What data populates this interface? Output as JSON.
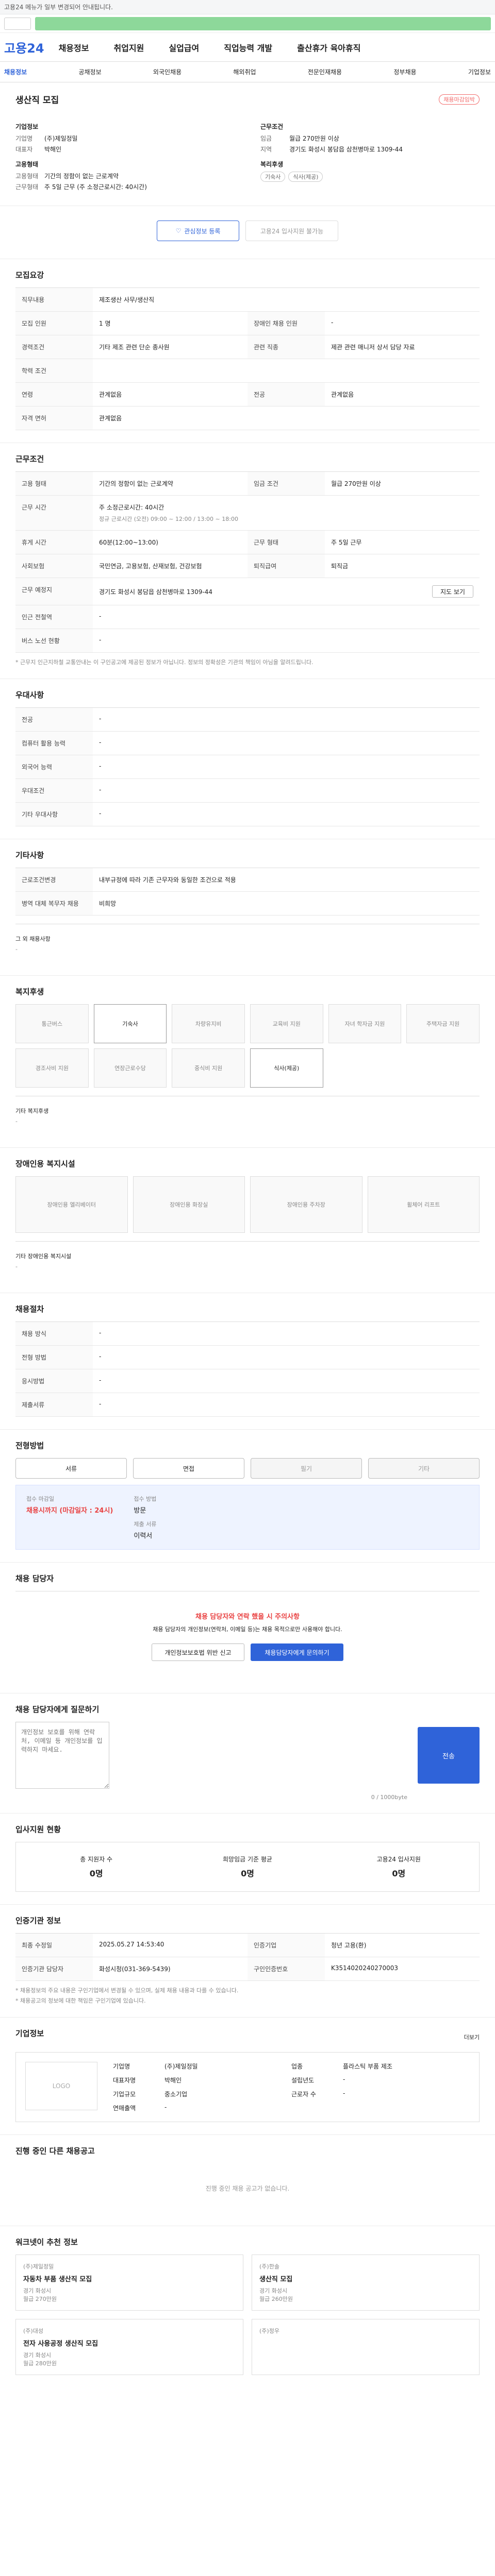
{
  "top_notice": "고용24 메뉴가 일부 변경되어 안내됩니다.",
  "ad_banner": "",
  "brand": {
    "name": "고용24"
  },
  "nav": [
    "채용정보",
    "취업지원",
    "실업급여",
    "직업능력 개발",
    "출산휴가 육아휴직"
  ],
  "subnav": [
    "채용정보",
    "공채정보",
    "외국인채용",
    "해외취업",
    "전문인재채용",
    "정부채용",
    "기업정보"
  ],
  "job": {
    "title": "생산직 모집",
    "badge": "채용마감임박",
    "company_label": "기업정보",
    "company_name": "(주)제일정밀",
    "representative": "박해인",
    "industry": "",
    "work_condition_label": "근무조건",
    "pay_label": "임금",
    "pay_value": "월급 270만원 이상",
    "location_label": "지역",
    "location_value": "경기도 화성시 봉담읍 삼천병마로 1309-44",
    "hire_type_label": "고용형태",
    "hire_type_value": "기간의 정함이 없는 근로계약",
    "working_form_label": "근무형태",
    "working_form_value": "주 5일 근무 (주 소정근로시간: 40시간)",
    "welfare_label": "복리후생",
    "welfare_items": [
      "기숙사",
      "식사(제공)"
    ]
  },
  "actions": {
    "interest_btn": "관심정보 등록",
    "apply_btn": "고용24 입사지원 불가능"
  },
  "recruit": {
    "title": "모집요강",
    "job_label": "직무내용",
    "job_value": "제조생산 사무/생산직",
    "rows": [
      {
        "k": "모집 인원",
        "v": "1 명",
        "k2": "장애인 채용 인원",
        "v2": "-"
      },
      {
        "k": "경력조건",
        "v": "기타 제조 관련 단순 종사원",
        "k2": "관련 직종",
        "v2": "제관 관련 매니저 상서 담당 자료"
      },
      {
        "k": "학력 조건",
        "v": "",
        "k2": "",
        "v2": ""
      },
      {
        "k": "연령",
        "v": "관계없음",
        "k2": "전공",
        "v2": "관계없음"
      },
      {
        "k": "자격 면허",
        "v": "관계없음",
        "k2": "",
        "v2": ""
      }
    ]
  },
  "conditions": {
    "title": "근무조건",
    "rows": [
      {
        "k": "고용 형태",
        "v": "기간의 정함이 없는 근로계약",
        "k2": "임금 조건",
        "v2": "월급 270만원 이상"
      },
      {
        "k": "근무 시간",
        "v": "주 소정근로시간: 40시간",
        "k2": "",
        "v2": ""
      },
      {
        "k": "",
        "v": "정규 근로시간 (오전) 09:00 ~ 12:00 / 13:00 ~ 18:00",
        "k2": "",
        "v2": ""
      },
      {
        "k": "휴게 시간",
        "v": "60분(12:00~13:00)",
        "k2": "근무 형태",
        "v2": "주 5일 근무"
      },
      {
        "k": "사회보험",
        "v": "국민연금, 고용보험, 산재보험, 건강보험",
        "k2": "퇴직급여",
        "v2": "퇴직금"
      },
      {
        "k": "근무 예정지",
        "v": "경기도 화성시 봉담읍 삼천병마로 1309-44",
        "k2": "",
        "v2": ""
      },
      {
        "k": "인근 전철역",
        "v": "-",
        "k2": "",
        "v2": ""
      },
      {
        "k": "버스 노선 현황",
        "v": "-",
        "k2": "",
        "v2": ""
      }
    ],
    "note": "* 근무지 인근지하철 교통안내는 이 구인공고에 제공된 정보가 아닙니다. 정보의 정확성은 기관의 책임이 아님을 알려드립니다.",
    "map_btn": "지도 보기"
  },
  "extra": {
    "title": "우대사항",
    "rows": [
      {
        "k": "전공",
        "v": "-"
      },
      {
        "k": "컴퓨터 활용 능력",
        "v": "-"
      },
      {
        "k": "외국어 능력",
        "v": "-"
      },
      {
        "k": "우대조건",
        "v": "-"
      },
      {
        "k": "기타 우대사항",
        "v": "-"
      }
    ]
  },
  "other": {
    "title": "기타사항",
    "rows": [
      {
        "k": "근로조건변경",
        "v": "내부규정에 따라 기존 근무자와 동일한 조건으로 적용"
      },
      {
        "k": "병역 대체 복무자 채용",
        "v": "비희망"
      },
      {
        "k": "그 외 채용사항",
        "v": "-"
      }
    ]
  },
  "benefits": {
    "title": "복지후생",
    "items": [
      "통근버스",
      "기숙사",
      "차량유지비",
      "교육비 지원",
      "자녀 학자금 지원",
      "주택자금 지원",
      "경조사비 지원",
      "연장근로수당",
      "중식비 지원",
      "식사(제공)"
    ],
    "active_indexes": [
      1,
      9
    ],
    "other_label": "기타 복지후생",
    "other_value": "-"
  },
  "disability": {
    "title": "장애인용 복지시설",
    "items": [
      "장애인용 엘리베이터",
      "장애인용 화장실",
      "장애인용 주차장",
      "휠체어 리프트"
    ],
    "other_label": "기타 장애인용 복지시설",
    "other_value": "-"
  },
  "process": {
    "title": "채용절차",
    "rows": [
      {
        "k": "채용 방식",
        "v": "-",
        "k2": "",
        "v2": ""
      },
      {
        "k": "전형 방법",
        "v": "-",
        "k2": "",
        "v2": ""
      },
      {
        "k": "응시방법",
        "v": "-",
        "k2": "",
        "v2": ""
      },
      {
        "k": "제출서류",
        "v": "-",
        "k2": "",
        "v2": ""
      }
    ]
  },
  "selection": {
    "title": "전형방법",
    "steps": [
      "서류",
      "면접",
      "필기",
      "기타"
    ],
    "period_label": "접수 마감일",
    "period_value": "채용시까지 (마감일자 : 24시)",
    "method_label": "접수 방법",
    "method_value": "방문",
    "doc_label": "제출 서류",
    "doc_value": "이력서"
  },
  "warning": {
    "title": "채용 담당자",
    "head": "채용 담당자와 연락 했을 시 주의사항",
    "text": "채용 담당자의 개인정보(연락처, 이메일 등)는 채용 목적으로만 사용해야 합니다.",
    "btn1": "개인정보보호법 위반 신고",
    "btn2": "채용담당자에게 문의하기"
  },
  "qa": {
    "title": "채용 담당자에게 질문하기",
    "placeholder": "개인정보 보호를 위해 연락처, 이메일 등 개인정보를 입력하지 마세요.",
    "counter": "0 / 1000byte",
    "submit": "전송"
  },
  "applicants": {
    "title": "입사지원 현황",
    "stats": [
      {
        "label": "총 지원자 수",
        "value": "0명"
      },
      {
        "label": "희망임금 기준 평균",
        "value": "0명"
      },
      {
        "label": "고용24 입사지원",
        "value": "0명"
      }
    ]
  },
  "info": {
    "title": "인증기관 정보",
    "rows": [
      {
        "k": "최종 수정일",
        "v": "2025.05.27 14:53:40",
        "k2": "인증기업",
        "v2": "청년 고용(환)"
      },
      {
        "k": "인증기관 담당자",
        "v": "화성시청(031-369-5439)",
        "k2": "구인인증번호",
        "v2": "K3514020240270003"
      }
    ],
    "notes": [
      "* 채용정보의 주요 내용은 구인기업에서 변경될 수 있으며, 실제 채용 내용과 다를 수 있습니다.",
      "* 채용공고의 정보에 대한 책임은 구인기업에 있습니다."
    ]
  },
  "company": {
    "title": "기업정보",
    "more": "더보기",
    "logo_alt": "LOGO",
    "rows": [
      {
        "k": "기업명",
        "v": "(주)제일정밀"
      },
      {
        "k": "업종",
        "v": "플라스틱 부품 제조"
      },
      {
        "k": "대표자명",
        "v": "박해인"
      },
      {
        "k": "설립년도",
        "v": "-"
      },
      {
        "k": "기업규모",
        "v": "중소기업"
      },
      {
        "k": "근로자 수",
        "v": "-"
      },
      {
        "k": "연매출액",
        "v": "-"
      }
    ]
  },
  "other_jobs": {
    "title": "진행 중인 다른 채용공고",
    "empty": "진행 중인 채용 공고가 없습니다.",
    "recommend_title": "워크넷이 추천 정보",
    "cards": [
      {
        "company": "(주)제일정밀",
        "name": "자동차 부품 생산직 모집",
        "loc": "경기 화성시",
        "pay": "월급 270만원"
      },
      {
        "company": "(주)한솔",
        "name": "생산직 모집",
        "loc": "경기 화성시",
        "pay": "월급 260만원"
      },
      {
        "company": "(주)대성",
        "name": "전자 사용공정 생산직 모집",
        "loc": "경기 화성시",
        "pay": "월급 280만원"
      },
      {
        "company": "(주)정우",
        "name": "",
        "loc": "",
        "pay": ""
      }
    ]
  }
}
